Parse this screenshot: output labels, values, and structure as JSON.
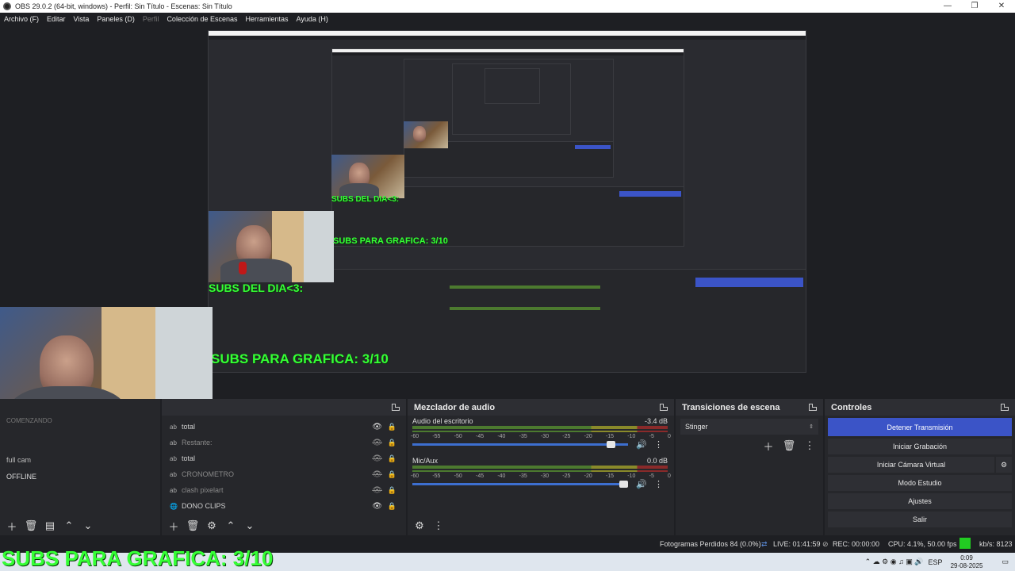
{
  "window": {
    "title": "OBS 29.0.2 (64-bit, windows) - Perfil: Sin Título - Escenas: Sin Título",
    "minimize": "—",
    "maximize": "❐",
    "close": "✕"
  },
  "menu": {
    "items": [
      "Archivo (F)",
      "Editar",
      "Vista",
      "Paneles (D)",
      "Perfil",
      "Colección de Escenas",
      "Herramientas",
      "Ayuda (H)"
    ]
  },
  "preview": {
    "overlay_subs_dia": "SUBS DEL DIA<3:",
    "overlay_subs_grafica": "SUBS PARA GRAFICA: 3/10"
  },
  "scenes_dock": {
    "items": [
      "COMENZANDO",
      "full cam",
      "OFFLINE"
    ]
  },
  "sources_dock": {
    "items": [
      {
        "name": "total",
        "type": "text",
        "visible": true
      },
      {
        "name": "Restante:",
        "type": "text",
        "visible": false
      },
      {
        "name": "total",
        "type": "text",
        "visible": false
      },
      {
        "name": "CRONOMETRO",
        "type": "text",
        "visible": false
      },
      {
        "name": "clash pixelart",
        "type": "text",
        "visible": false
      },
      {
        "name": "DONO CLIPS",
        "type": "browser",
        "visible": true
      }
    ]
  },
  "mixer": {
    "title": "Mezclador de audio",
    "scale": [
      "-60",
      "-55",
      "-50",
      "-45",
      "-40",
      "-35",
      "-30",
      "-25",
      "-20",
      "-15",
      "-10",
      "-5",
      "0"
    ],
    "channels": [
      {
        "name": "Audio del escritorio",
        "db": "-3.4 dB",
        "level": 0.94
      },
      {
        "name": "Mic/Aux",
        "db": "0.0 dB",
        "level": 1.0
      }
    ]
  },
  "transitions": {
    "title": "Transiciones de escena",
    "selected": "Stinger"
  },
  "controls": {
    "title": "Controles",
    "buttons": [
      "Detener Transmisión",
      "Iniciar Grabación",
      "Iniciar Cámara Virtual",
      "Modo Estudio",
      "Ajustes",
      "Salir"
    ]
  },
  "status": {
    "dropped": "Fotogramas Perdidos 84 (0.0%)",
    "live": "LIVE: 01:41:59",
    "rec": "REC: 00:00:00",
    "cpu": "CPU: 4.1%, 50.00 fps",
    "kbs": "kb/s: 8123"
  },
  "taskbar": {
    "lang": "ESP",
    "time": "0:09",
    "date": "29-08-2025"
  },
  "colors": {
    "accent": "#3b54c7",
    "overlay_green": "#35ff35",
    "live_indicator": "#22cc22"
  }
}
